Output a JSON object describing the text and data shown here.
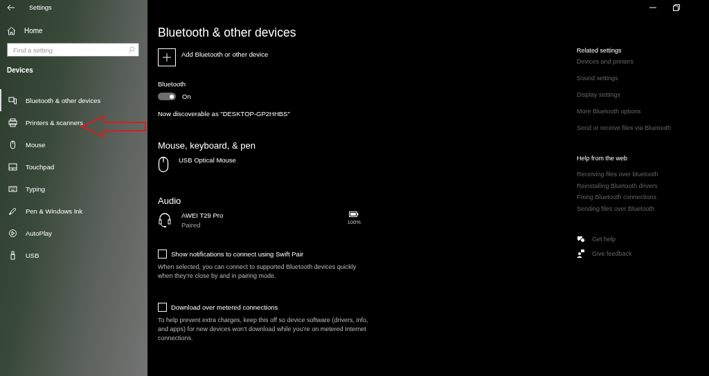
{
  "window": {
    "title": "Settings"
  },
  "sidebar": {
    "home": "Home",
    "search": {
      "placeholder": "Find a setting"
    },
    "section": "Devices",
    "items": [
      {
        "label": "Bluetooth & other devices",
        "selected": true
      },
      {
        "label": "Printers & scanners",
        "selected": false
      },
      {
        "label": "Mouse",
        "selected": false
      },
      {
        "label": "Touchpad",
        "selected": false
      },
      {
        "label": "Typing",
        "selected": false
      },
      {
        "label": "Pen & Windows Ink",
        "selected": false
      },
      {
        "label": "AutoPlay",
        "selected": false
      },
      {
        "label": "USB",
        "selected": false
      }
    ]
  },
  "main": {
    "title": "Bluetooth & other devices",
    "add_device": "Add Bluetooth or other device",
    "bluetooth": {
      "label": "Bluetooth",
      "on": true,
      "state_text": "On"
    },
    "discoverable": "Now discoverable as \"DESKTOP-GP2HHBS\"",
    "groups": [
      {
        "heading": "Mouse, keyboard, & pen",
        "devices": [
          {
            "kind": "mouse",
            "name": "USB Optical Mouse"
          }
        ]
      },
      {
        "heading": "Audio",
        "devices": [
          {
            "kind": "headset",
            "name": "AWEI T29 Pro",
            "status": "Paired",
            "battery": "100%"
          }
        ]
      }
    ],
    "options": [
      {
        "label": "Show notifications to connect using Swift Pair",
        "checked": false,
        "description": "When selected, you can connect to supported Bluetooth devices quickly when they’re close by and in pairing mode."
      },
      {
        "label": "Download over metered connections",
        "checked": false,
        "description": "To help prevent extra charges, keep this off so device software (drivers, info, and apps) for new devices won’t download while you’re on metered Internet connections."
      }
    ]
  },
  "related": {
    "heading": "Related settings",
    "links": [
      "Devices and printers",
      "Sound settings",
      "Display settings",
      "More Bluetooth options",
      "Send or receive files via Bluetooth"
    ]
  },
  "help": {
    "heading": "Help from the web",
    "links": [
      "Receiving files over bluetooth",
      "Reinstalling Bluetooth drivers",
      "Fixing Bluetooth connections",
      "Sending files over Bluetooth"
    ]
  },
  "support": [
    {
      "kind": "help",
      "label": "Get help"
    },
    {
      "kind": "feedback",
      "label": "Give feedback"
    }
  ]
}
